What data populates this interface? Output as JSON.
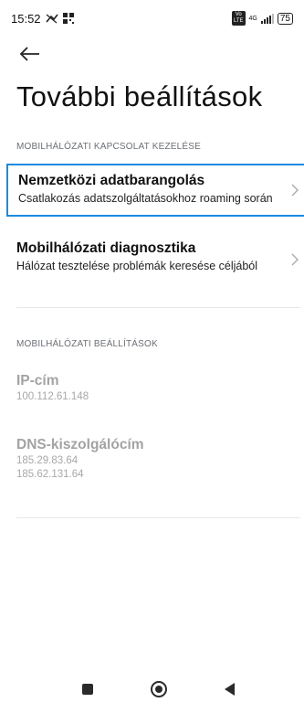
{
  "status_bar": {
    "time": "15:52",
    "network_label": "4G",
    "battery": "75",
    "volte": "Vo\nLTE"
  },
  "page": {
    "title": "További beállítások"
  },
  "sections": {
    "connection_header": "MOBILHÁLÓZATI KAPCSOLAT KEZELÉSE",
    "roaming_title": "Nemzetközi adatbarangolás",
    "roaming_sub": "Csatlakozás adatszolgáltatásokhoz roaming során",
    "diag_title": "Mobilhálózati diagnosztika",
    "diag_sub": "Hálózat tesztelése problémák keresése céljából",
    "settings_header": "MOBILHÁLÓZATI BEÁLLÍTÁSOK",
    "ip_title": "IP-cím",
    "ip_value": "100.112.61.148",
    "dns_title": "DNS-kiszolgálócím",
    "dns_value_1": "185.29.83.64",
    "dns_value_2": "185.62.131.64"
  },
  "icons": {
    "back": "back-arrow-icon",
    "chevron": "chevron-right-icon",
    "nav_recents": "square-icon",
    "nav_home": "circle-icon",
    "nav_back": "triangle-icon"
  },
  "colors": {
    "selection": "#1a8be0",
    "muted": "#a3a3a3"
  }
}
